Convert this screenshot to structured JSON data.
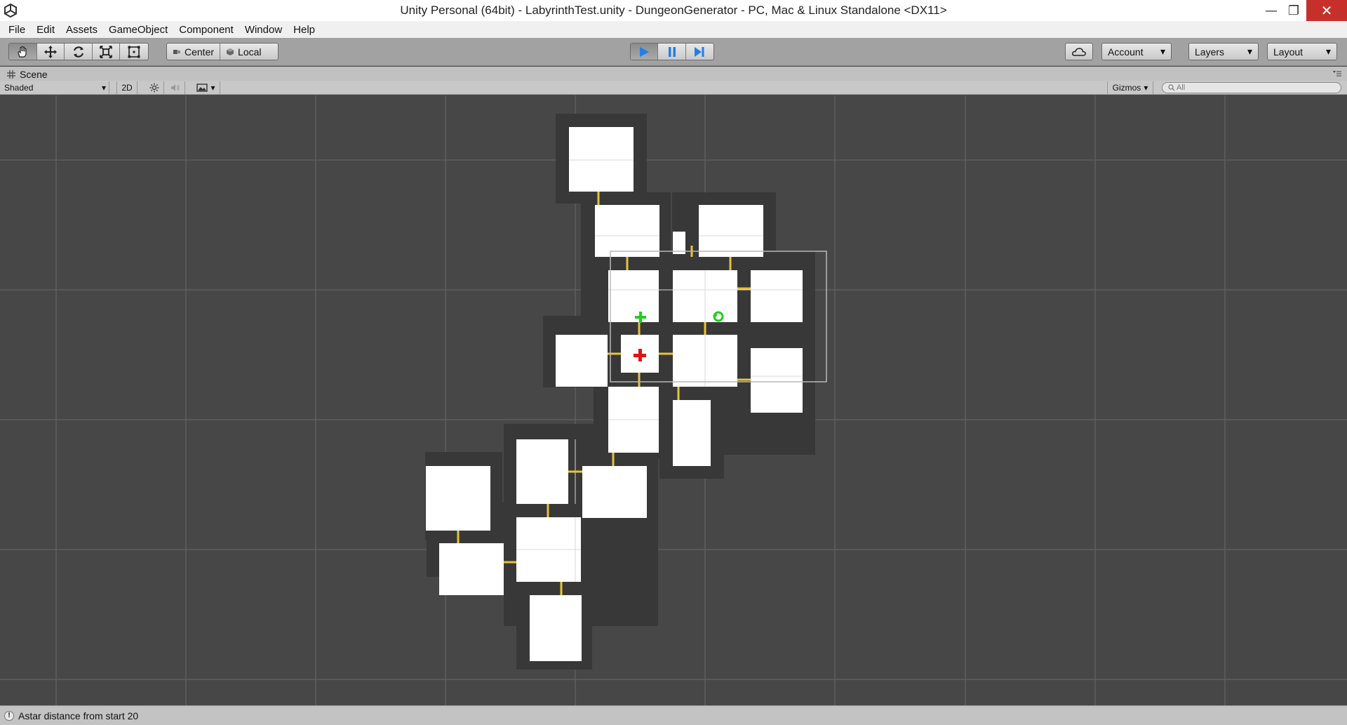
{
  "window": {
    "title": "Unity Personal (64bit) - LabyrinthTest.unity - DungeonGenerator - PC, Mac & Linux Standalone <DX11>",
    "min_glyph": "—",
    "max_glyph": "❐",
    "close_glyph": "✕"
  },
  "menu": [
    "File",
    "Edit",
    "Assets",
    "GameObject",
    "Component",
    "Window",
    "Help"
  ],
  "toolbar": {
    "pivot_center": "Center",
    "pivot_local": "Local",
    "account": "Account",
    "layers": "Layers",
    "layout": "Layout",
    "dropdown_arrow": "▾"
  },
  "scene": {
    "tab_label": "Scene",
    "shading_mode": "Shaded",
    "mode_2d": "2D",
    "gizmos": "Gizmos",
    "search_placeholder": "All"
  },
  "status": {
    "message": "Astar distance from start 20"
  },
  "colors": {
    "room_fill": "#ffffff",
    "room_shadow": "#383838",
    "door": "#e8c33a",
    "start_marker": "#22cc22",
    "end_marker": "#e01414",
    "play_accent": "#1f7fe6"
  },
  "icons": {
    "tools": [
      "hand-icon",
      "move-icon",
      "rotate-icon",
      "scale-icon",
      "rect-tool-icon"
    ],
    "play": [
      "play-icon",
      "pause-icon",
      "step-icon"
    ]
  }
}
